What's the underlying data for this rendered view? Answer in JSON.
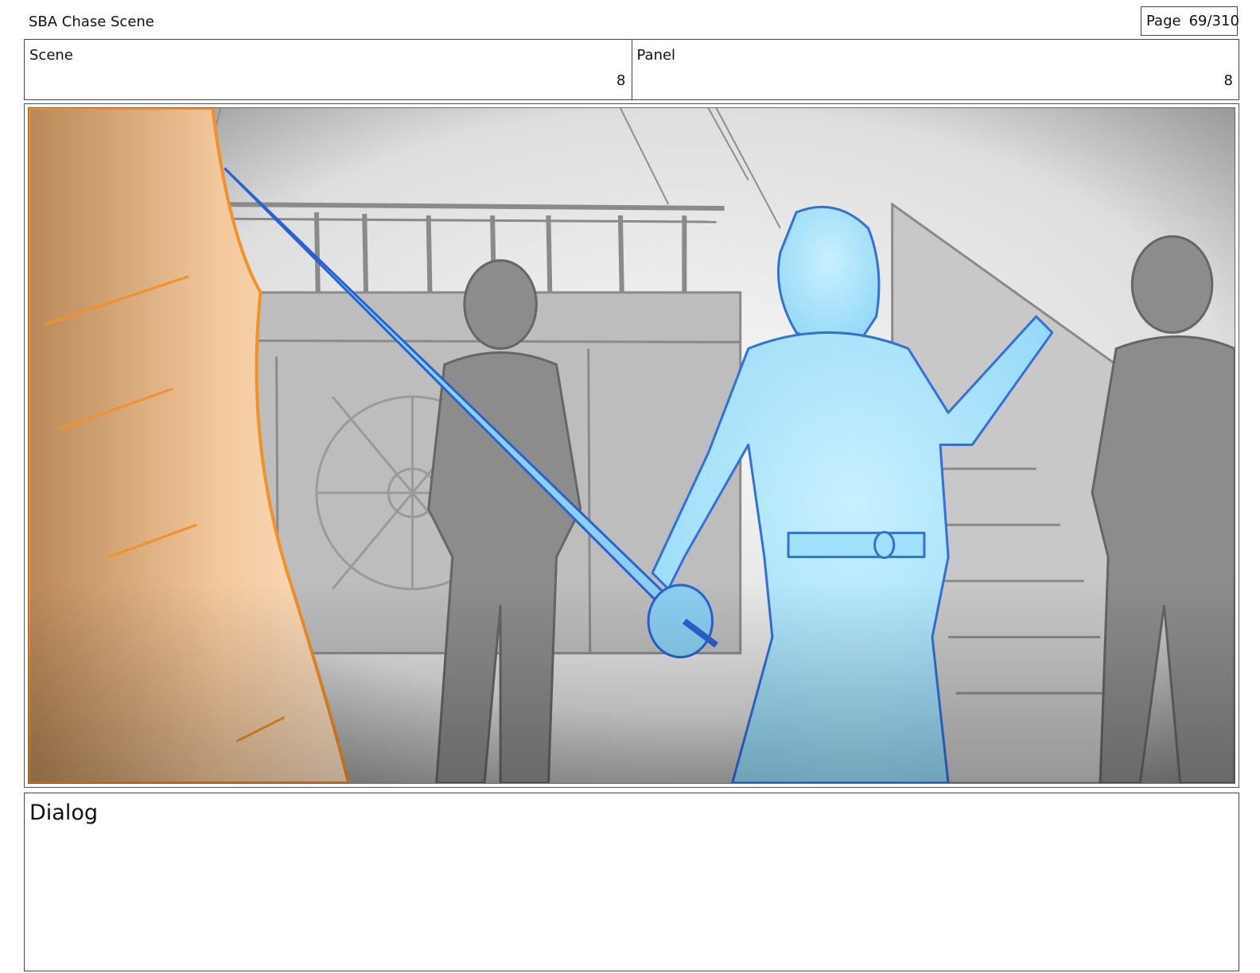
{
  "header": {
    "title": "SBA Chase Scene",
    "page_label": "Page",
    "page_number": "69/310"
  },
  "info": {
    "scene_label": "Scene",
    "scene_value": "8",
    "panel_label": "Panel",
    "panel_value": "8"
  },
  "panel": {
    "description_colors": {
      "foreground_figure": "#f0a050",
      "hero_figure": "#8fd8f8",
      "background_figures": "#8c8c8c"
    }
  },
  "dialog": {
    "label": "Dialog",
    "text": ""
  }
}
